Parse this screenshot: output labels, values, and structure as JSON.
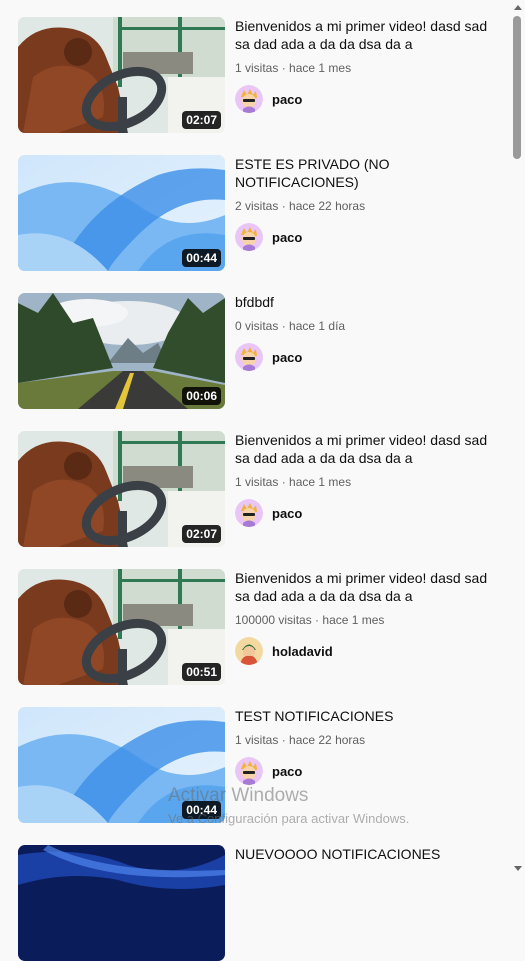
{
  "videos": [
    {
      "title": "Bienvenidos a mi primer video! dasd sad sa dad ada a da da dsa da a",
      "views": "1 visitas",
      "time": "hace 1 mes",
      "duration": "02:07",
      "channel": "paco",
      "thumb": "orangutan",
      "avatar": "paco-avatar"
    },
    {
      "title": "ESTE ES PRIVADO (NO NOTIFICACIONES)",
      "views": "2 visitas",
      "time": "hace 22 horas",
      "duration": "00:44",
      "channel": "paco",
      "thumb": "blue-abstract",
      "avatar": "paco-avatar"
    },
    {
      "title": "bfdbdf",
      "views": "0 visitas",
      "time": "hace 1 día",
      "duration": "00:06",
      "channel": "paco",
      "thumb": "forest-road",
      "avatar": "paco-avatar"
    },
    {
      "title": "Bienvenidos a mi primer video! dasd sad sa dad ada a da da dsa da a",
      "views": "1 visitas",
      "time": "hace 1 mes",
      "duration": "02:07",
      "channel": "paco",
      "thumb": "orangutan",
      "avatar": "paco-avatar"
    },
    {
      "title": "Bienvenidos a mi primer video! dasd sad sa dad ada a da da dsa da a",
      "views": "100000 visitas",
      "time": "hace 1 mes",
      "duration": "00:51",
      "channel": "holadavid",
      "thumb": "orangutan",
      "avatar": "holadavid-avatar"
    },
    {
      "title": "TEST NOTIFICACIONES",
      "views": "1 visitas",
      "time": "hace 22 horas",
      "duration": "00:44",
      "channel": "paco",
      "thumb": "blue-abstract",
      "avatar": "paco-avatar"
    },
    {
      "title": "NUEVOOOO NOTIFICACIONES",
      "views": "",
      "time": "",
      "duration": "",
      "channel": "",
      "thumb": "dark-blue",
      "avatar": ""
    }
  ],
  "separator": " · ",
  "watermark": {
    "line1": "Activar Windows",
    "line2": "Ve a Configuración para activar Windows."
  },
  "colors": {
    "background": "#f9f9f9",
    "meta_text": "#606060",
    "duration_bg": "#000000"
  }
}
